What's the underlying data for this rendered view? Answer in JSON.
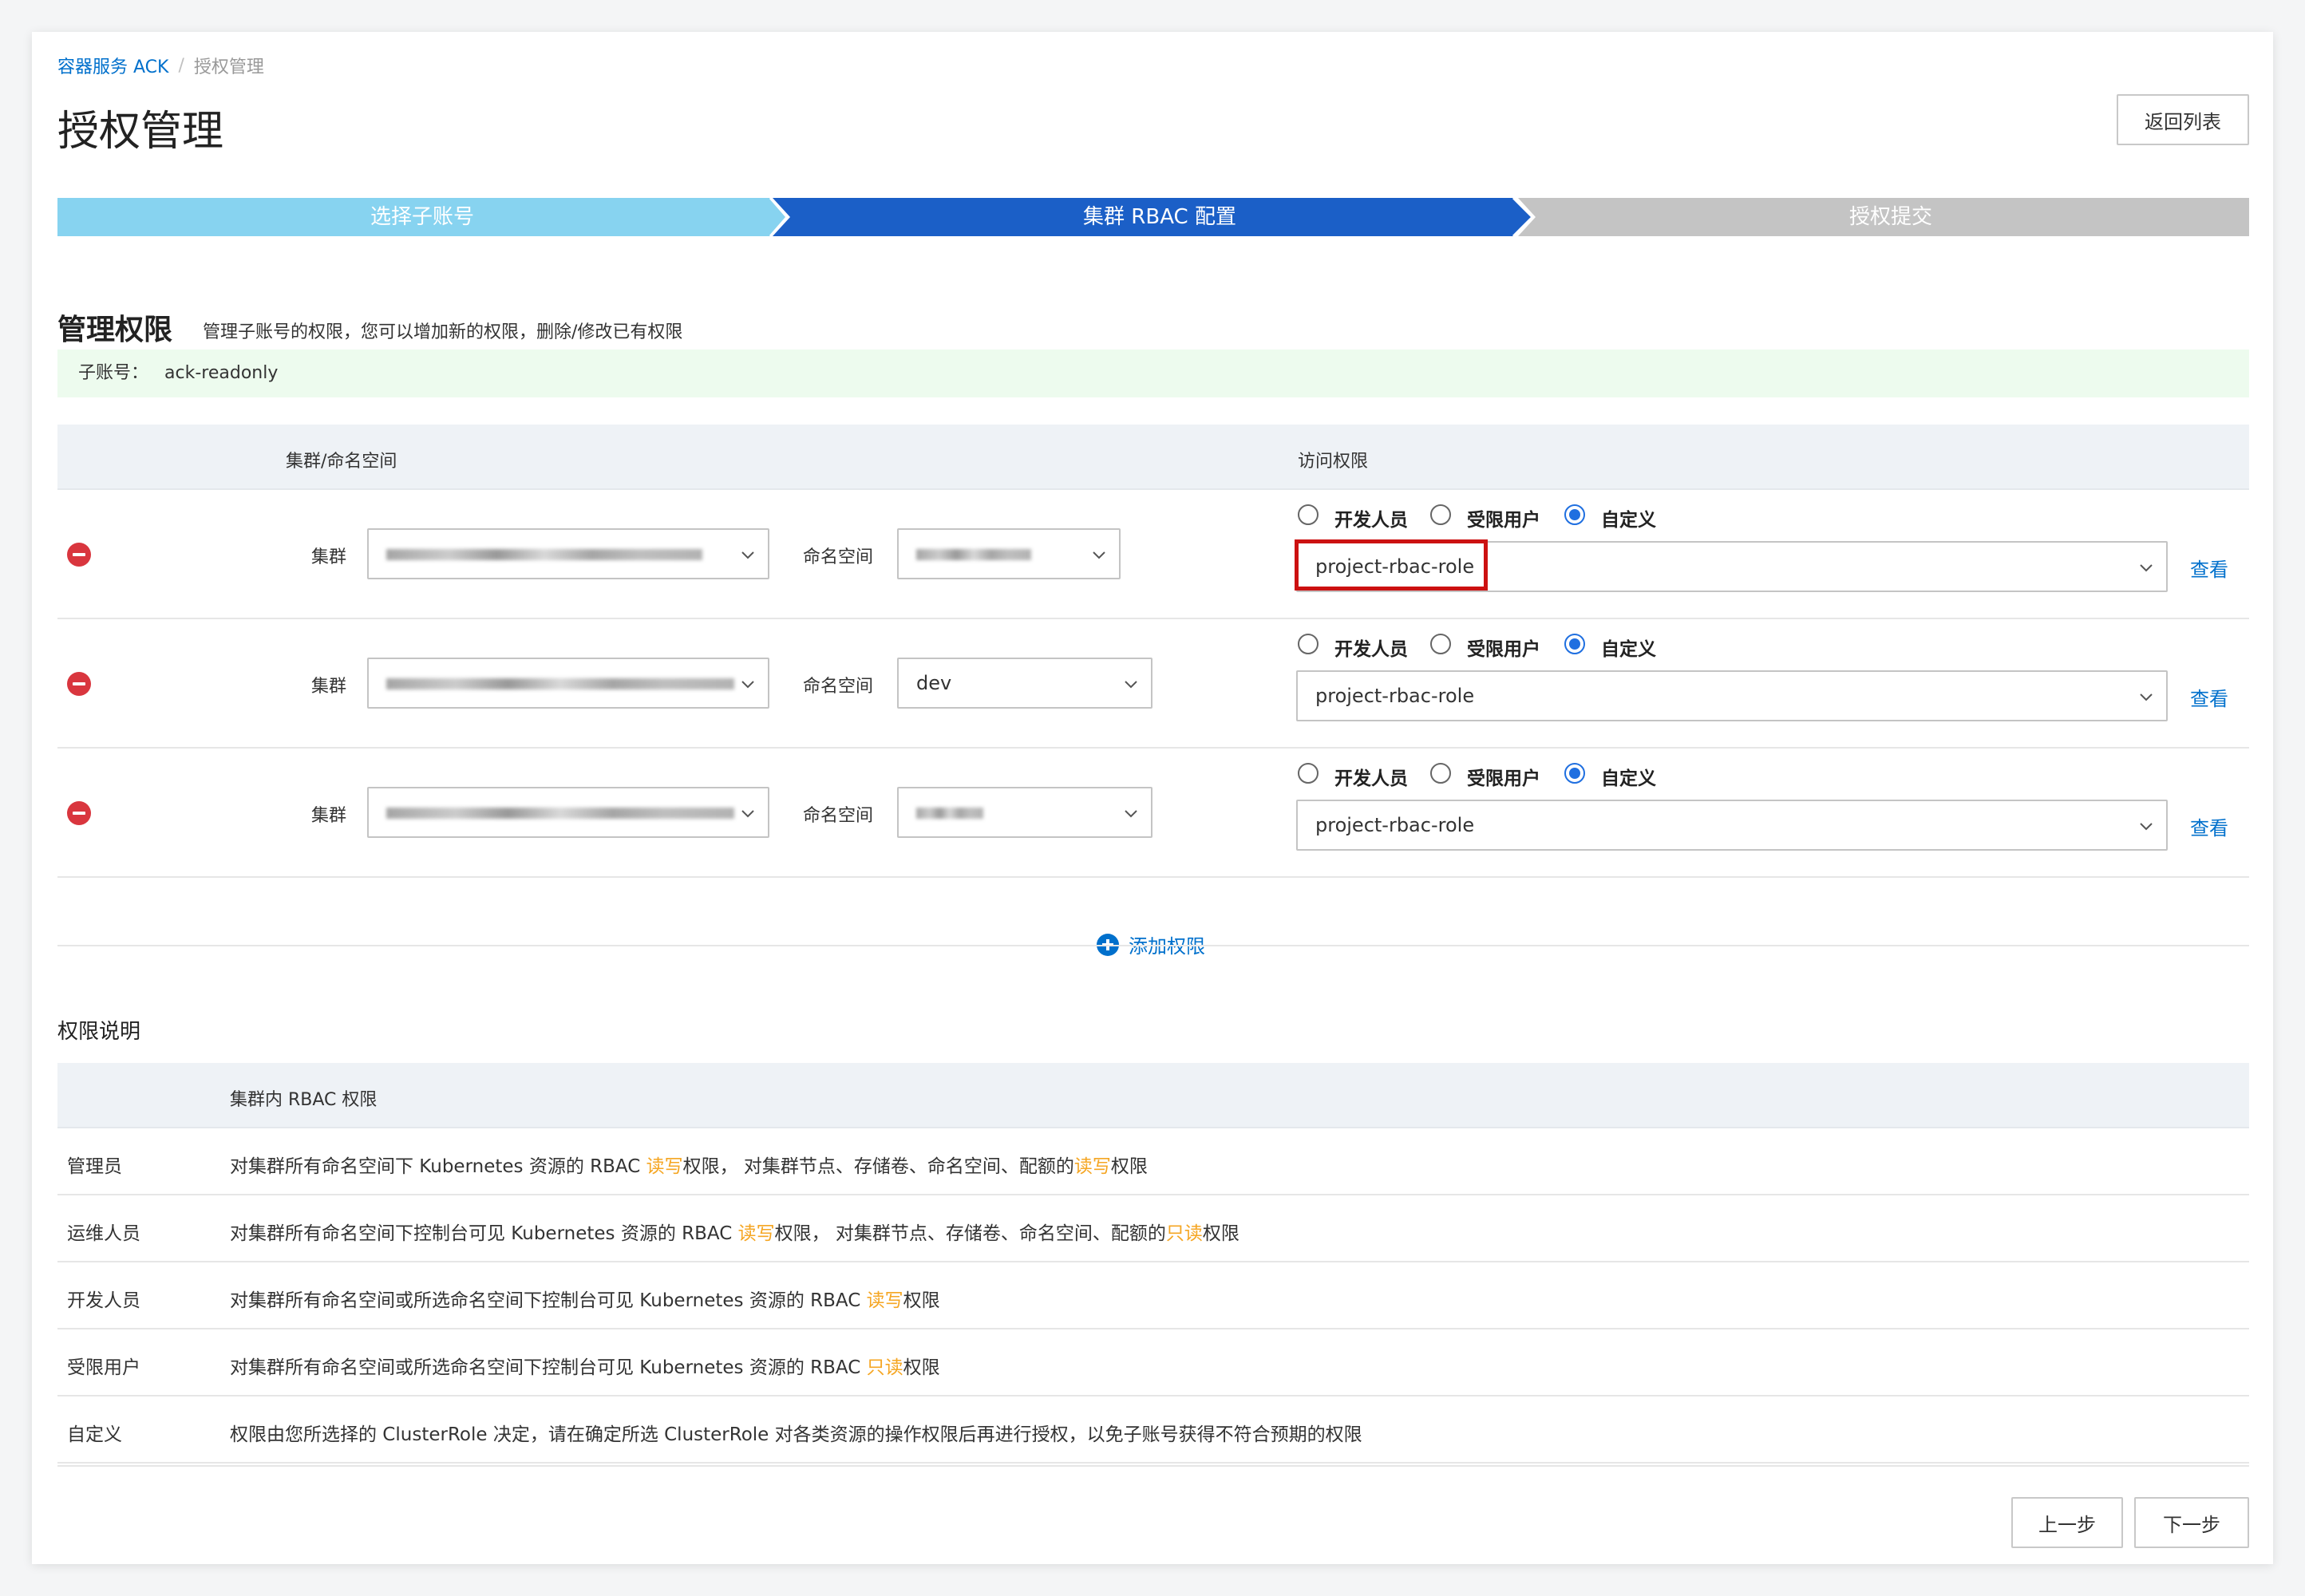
{
  "breadcrumb": {
    "root": "容器服务 ACK",
    "sep": "/",
    "current": "授权管理"
  },
  "page_title": "授权管理",
  "back_button": "返回列表",
  "steps": [
    "选择子账号",
    "集群 RBAC 配置",
    "授权提交"
  ],
  "steps_active_index": 1,
  "colors": {
    "step_done": "#87d3f0",
    "step_active": "#1b5fc7",
    "step_pending": "#c4c4c4",
    "link": "#0070cc",
    "highlight_text": "#f5a623",
    "account_bar": "#edfbee"
  },
  "manage": {
    "title": "管理权限",
    "desc": "管理子账号的权限，您可以增加新的权限，删除/修改已有权限",
    "account_label": "子账号：",
    "account_value": "ack-readonly"
  },
  "perm_table": {
    "col_cluster_ns": "集群/命名空间",
    "col_access": "访问权限",
    "cluster_label": "集群",
    "namespace_label": "命名空间",
    "radio_options": [
      "开发人员",
      "受限用户",
      "自定义"
    ],
    "view_label": "查看",
    "rows": [
      {
        "namespace": "",
        "role": "project-rbac-role",
        "selected_radio": "自定义"
      },
      {
        "namespace": "dev",
        "role": "project-rbac-role",
        "selected_radio": "自定义"
      },
      {
        "namespace": "",
        "role": "project-rbac-role",
        "selected_radio": "自定义"
      }
    ],
    "add_label": "添加权限"
  },
  "desc_section": {
    "title": "权限说明",
    "col_header": "集群内 RBAC 权限",
    "rows": [
      {
        "role": "管理员",
        "parts": [
          "对集群所有命名空间下 Kubernetes 资源的 RBAC ",
          "读写",
          "权限， 对集群节点、存储卷、命名空间、配额的",
          "读写",
          "权限"
        ]
      },
      {
        "role": "运维人员",
        "parts": [
          "对集群所有命名空间下控制台可见 Kubernetes 资源的 RBAC ",
          "读写",
          "权限， 对集群节点、存储卷、命名空间、配额的",
          "只读",
          "权限"
        ]
      },
      {
        "role": "开发人员",
        "parts": [
          "对集群所有命名空间或所选命名空间下控制台可见 Kubernetes 资源的 RBAC ",
          "读写",
          "权限"
        ]
      },
      {
        "role": "受限用户",
        "parts": [
          "对集群所有命名空间或所选命名空间下控制台可见 Kubernetes 资源的 RBAC ",
          "只读",
          "权限"
        ]
      },
      {
        "role": "自定义",
        "warning": "权限由您所选择的 ClusterRole 决定，请在确定所选 ClusterRole 对各类资源的操作权限后再进行授权，以免子账号获得不符合预期的权限"
      }
    ]
  },
  "footer": {
    "prev": "上一步",
    "next": "下一步"
  }
}
